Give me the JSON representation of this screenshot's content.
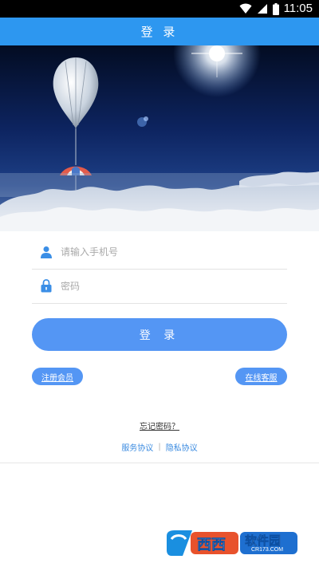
{
  "status_bar": {
    "time": "11:05"
  },
  "title_bar": {
    "title": "登 录"
  },
  "form": {
    "phone_placeholder": "请输入手机号",
    "password_placeholder": "密码",
    "login_label": "登 录"
  },
  "links": {
    "register_label": "注册会员",
    "service_label": "在线客服",
    "forgot_label": "忘记密码？",
    "terms_label": "服务协议",
    "separator": "|",
    "privacy_label": "隐私协议"
  },
  "watermark": {
    "brand": "西西",
    "name": "软件园",
    "domain": "CR173.COM"
  },
  "colors": {
    "title_bar": "#2d97f0",
    "button": "#5496f4",
    "link": "#3b8be0",
    "icon": "#3a8ee6"
  },
  "icons": [
    "wifi-icon",
    "signal-icon",
    "battery-icon",
    "user-icon",
    "lock-icon"
  ]
}
